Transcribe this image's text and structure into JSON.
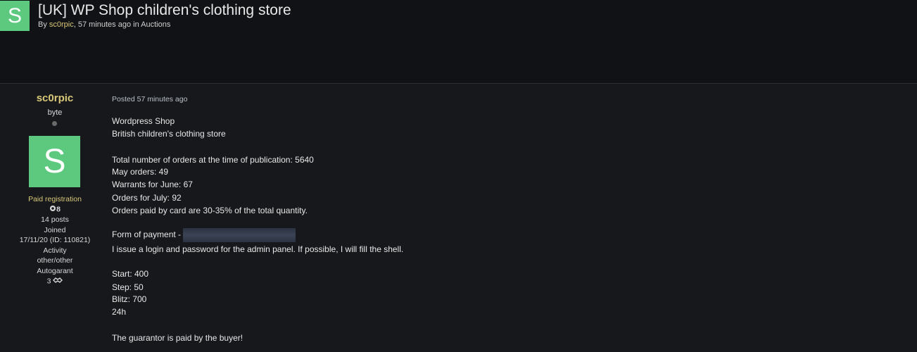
{
  "header": {
    "avatar_letter": "S",
    "title": "[UK] WP Shop children's clothing store",
    "meta_by": "By ",
    "meta_author": "sc0rpic",
    "meta_rest": ", 57 minutes ago in Auctions"
  },
  "author": {
    "name": "sc0rpic",
    "rank": "byte",
    "avatar_letter": "S",
    "group": "Paid registration",
    "reputation": "8",
    "posts": "14 posts",
    "joined_label": "Joined",
    "joined_value": "17/11/20 (ID: 110821)",
    "activity_label": "Activity",
    "activity_value": "other/other",
    "autogarant_label": "Autogarant",
    "autogarant_value": "3"
  },
  "post": {
    "posted": "Posted 57 minutes ago",
    "lines": [
      "Wordpress Shop",
      "British children's clothing store",
      "Total number of orders at the time of publication: 5640",
      "May orders: 49",
      "Warrants for June: 67",
      "Orders for July: 92",
      "Orders paid by card are 30-35% of the total quantity.",
      "Form of payment - ",
      "I issue a login and password for the admin panel. If possible, I will fill the shell.",
      "Start: 400",
      "Step: 50",
      "Blitz: 700",
      "24h",
      "The guarantor is paid by the buyer!"
    ]
  },
  "icons": {
    "reputation": "medal-icon",
    "autogarant": "handshake-icon"
  },
  "colors": {
    "background": "#17181c",
    "header_bg": "#111216",
    "accent_author": "#d9c878",
    "avatar_green": "#5cc97e"
  }
}
